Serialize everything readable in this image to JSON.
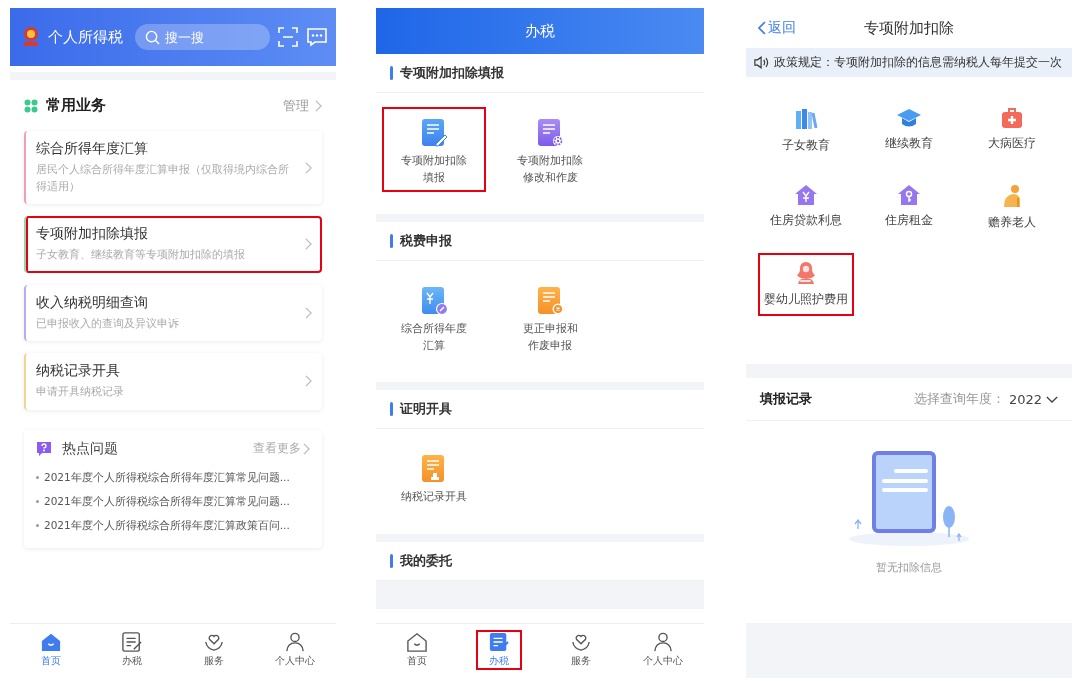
{
  "home": {
    "app_name": "个人所得税",
    "search": {
      "placeholder": "搜一搜"
    },
    "common": {
      "title": "常用业务",
      "manage": "管理"
    },
    "cards": [
      {
        "title": "综合所得年度汇算",
        "subtitle": "居民个人综合所得年度汇算申报（仅取得境内综合所得适用）",
        "color": "#f0a0b4",
        "highlighted": false
      },
      {
        "title": "专项附加扣除填报",
        "subtitle": "子女教育、继续教育等专项附加扣除的填报",
        "color": "#8fd9b0",
        "highlighted": true
      },
      {
        "title": "收入纳税明细查询",
        "subtitle": "已申报收入的查询及异议申诉",
        "color": "#b4aef0",
        "highlighted": false
      },
      {
        "title": "纳税记录开具",
        "subtitle": "申请开具纳税记录",
        "color": "#f5d58e",
        "highlighted": false
      }
    ],
    "hot": {
      "title": "热点问题",
      "more": "查看更多",
      "items": [
        "2021年度个人所得税综合所得年度汇算常见问题...",
        "2021年度个人所得税综合所得年度汇算常见问题...",
        "2021年度个人所得税综合所得年度汇算政策百问..."
      ]
    },
    "tab_bar": [
      {
        "label": "首页",
        "kind": "home",
        "selected": true,
        "highlighted": false
      },
      {
        "label": "办税",
        "kind": "doc",
        "selected": false,
        "highlighted": false
      },
      {
        "label": "服务",
        "kind": "heart",
        "selected": false,
        "highlighted": false
      },
      {
        "label": "个人中心",
        "kind": "person",
        "selected": false,
        "highlighted": false
      }
    ]
  },
  "tax": {
    "title": "办税",
    "sections": [
      {
        "title": "专项附加扣除填报",
        "items": [
          {
            "lines": [
              "专项附加扣除",
              "填报"
            ],
            "kind": "edit",
            "highlighted": true
          },
          {
            "lines": [
              "专项附加扣除",
              "修改和作废"
            ],
            "kind": "settings",
            "highlighted": false
          }
        ]
      },
      {
        "title": "税费申报",
        "items": [
          {
            "lines": [
              "综合所得年度",
              "汇算"
            ],
            "kind": "yuan",
            "highlighted": false
          },
          {
            "lines": [
              "更正申报和",
              "作废申报"
            ],
            "kind": "cancel",
            "highlighted": false
          }
        ]
      },
      {
        "title": "证明开具",
        "items": [
          {
            "lines": [
              "纳税记录开具"
            ],
            "kind": "certificate",
            "highlighted": false
          }
        ]
      },
      {
        "title": "我的委托"
      }
    ],
    "tab_bar": [
      {
        "label": "首页",
        "kind": "home",
        "selected": false,
        "highlighted": false
      },
      {
        "label": "办税",
        "kind": "doc",
        "selected": true,
        "highlighted": true
      },
      {
        "label": "服务",
        "kind": "heart",
        "selected": false,
        "highlighted": false
      },
      {
        "label": "个人中心",
        "kind": "person",
        "selected": false,
        "highlighted": false
      }
    ]
  },
  "deduction": {
    "back": "返回",
    "title": "专项附加扣除",
    "notice": "政策规定：专项附加扣除的信息需纳税人每年提交一次",
    "categories": [
      {
        "label": "子女教育",
        "kind": "books",
        "highlighted": false
      },
      {
        "label": "继续教育",
        "kind": "cap",
        "highlighted": false
      },
      {
        "label": "大病医疗",
        "kind": "medkit",
        "highlighted": false
      },
      {
        "label": "住房贷款利息",
        "kind": "house-yuan",
        "highlighted": false
      },
      {
        "label": "住房租金",
        "kind": "house-key",
        "highlighted": false
      },
      {
        "label": "赡养老人",
        "kind": "elder",
        "highlighted": false
      },
      {
        "label": "婴幼儿照护费用",
        "kind": "mother",
        "highlighted": true
      }
    ],
    "records": {
      "title": "填报记录",
      "year_label": "选择查询年度：",
      "year": "2022",
      "empty_text": "暂无扣除信息"
    }
  }
}
